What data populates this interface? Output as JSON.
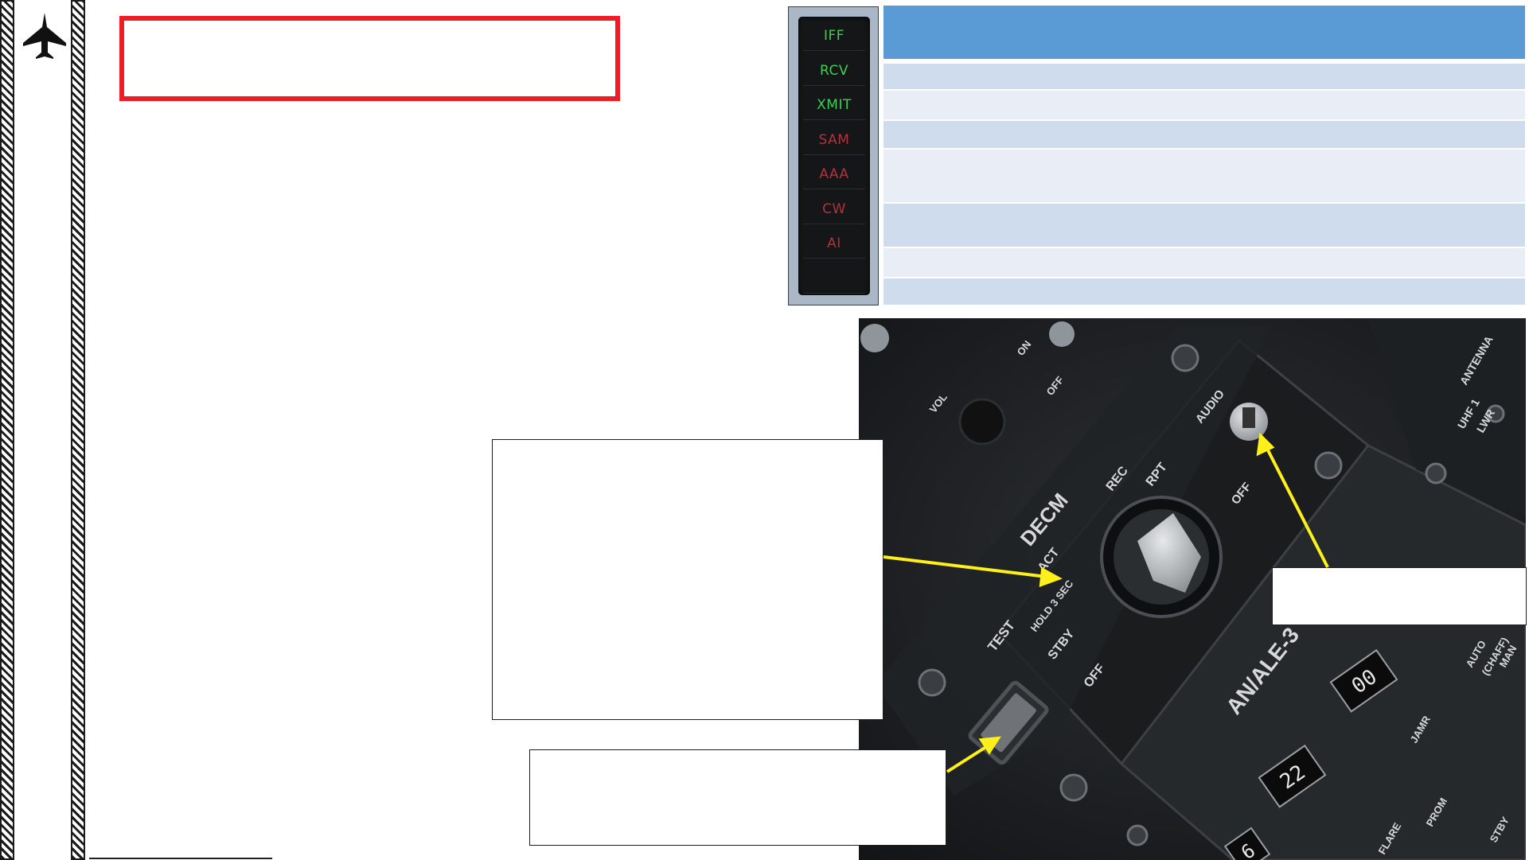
{
  "rwr_panel": {
    "labels": [
      {
        "text": "IFF",
        "color": "#3fcf54"
      },
      {
        "text": "RCV",
        "color": "#3fcf54"
      },
      {
        "text": "XMIT",
        "color": "#3fcf54"
      },
      {
        "text": "SAM",
        "color": "#b4323c"
      },
      {
        "text": "AAA",
        "color": "#b4323c"
      },
      {
        "text": "CW",
        "color": "#b4323c"
      },
      {
        "text": "AI",
        "color": "#b4323c"
      }
    ]
  },
  "cockpit_panel": {
    "decm_label": "DECM",
    "modes": [
      "TEST",
      "HOLD 3 SEC",
      "ACT",
      "STBY",
      "OFF",
      "REC",
      "RPT"
    ],
    "audio_label": "AUDIO",
    "audio_off_label": "OFF",
    "model_label": "AN/ALE-3",
    "top_labels": [
      "VOL",
      "ON",
      "OFF"
    ],
    "side_labels": [
      "ANTENNA",
      "UHF 1",
      "LWR",
      "AUTO",
      "(CHAFF)",
      "MAN",
      "JAMR",
      "PROM",
      "STBY",
      "FLARE"
    ],
    "counter_values": [
      "00",
      "22",
      "6"
    ]
  },
  "colors": {
    "accent_red": "#ee1c25",
    "table_header": "#5b9bd5",
    "table_row_dark": "#cfdcee",
    "table_row_light": "#e8edf6",
    "arrow": "#ffef1a"
  }
}
